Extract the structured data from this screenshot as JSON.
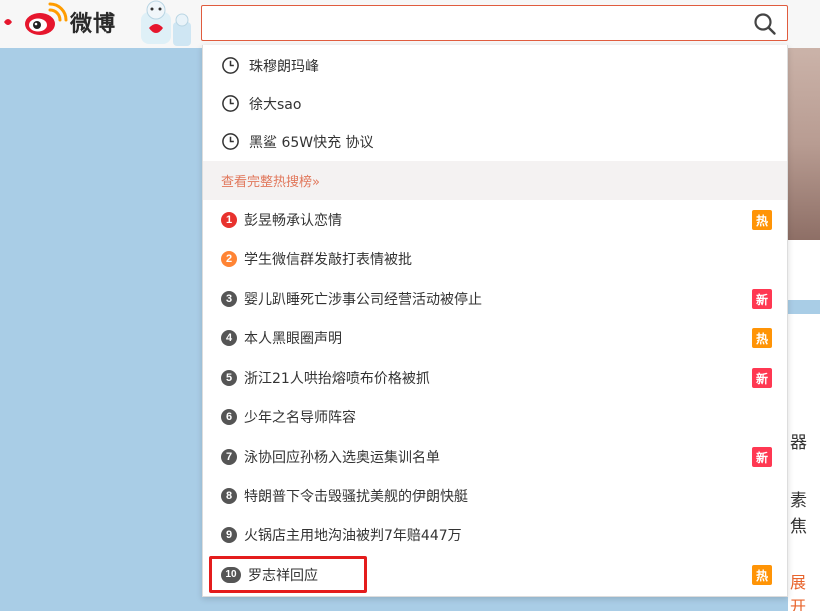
{
  "brand": {
    "logo_text": "微博"
  },
  "search": {
    "value": "",
    "placeholder": ""
  },
  "history": [
    {
      "text": "珠穆朗玛峰"
    },
    {
      "text": "徐大sao"
    },
    {
      "text": "黑鲨 65W快充 协议"
    }
  ],
  "full_list_link": "查看完整热搜榜»",
  "hot_list": [
    {
      "rank": "1",
      "text": "彭昱畅承认恋情",
      "badge": "热",
      "badge_type": "hot",
      "rank_color": "#e8322e"
    },
    {
      "rank": "2",
      "text": "学生微信群发敲打表情被批",
      "badge": "",
      "badge_type": "",
      "rank_color": "#ff8434"
    },
    {
      "rank": "3",
      "text": "婴儿趴睡死亡涉事公司经营活动被停止",
      "badge": "新",
      "badge_type": "new",
      "rank_color": "#555555"
    },
    {
      "rank": "4",
      "text": "本人黑眼圈声明",
      "badge": "热",
      "badge_type": "hot",
      "rank_color": "#555555"
    },
    {
      "rank": "5",
      "text": "浙江21人哄抬熔喷布价格被抓",
      "badge": "新",
      "badge_type": "new",
      "rank_color": "#555555"
    },
    {
      "rank": "6",
      "text": "少年之名导师阵容",
      "badge": "",
      "badge_type": "",
      "rank_color": "#555555"
    },
    {
      "rank": "7",
      "text": "泳协回应孙杨入选奥运集训名单",
      "badge": "新",
      "badge_type": "new",
      "rank_color": "#555555"
    },
    {
      "rank": "8",
      "text": "特朗普下令击毁骚扰美舰的伊朗快艇",
      "badge": "",
      "badge_type": "",
      "rank_color": "#555555"
    },
    {
      "rank": "9",
      "text": "火锅店主用地沟油被判7年赔447万",
      "badge": "",
      "badge_type": "",
      "rank_color": "#555555"
    },
    {
      "rank": "10",
      "text": "罗志祥回应",
      "badge": "热",
      "badge_type": "hot",
      "rank_color": "#555555"
    }
  ],
  "right_fragments": [
    "器",
    "素",
    "焦",
    "展开"
  ],
  "colors": {
    "accent": "#e05c3e",
    "hot": "#ff9406",
    "new": "#ff3852",
    "highlight": "#e41c1c"
  }
}
